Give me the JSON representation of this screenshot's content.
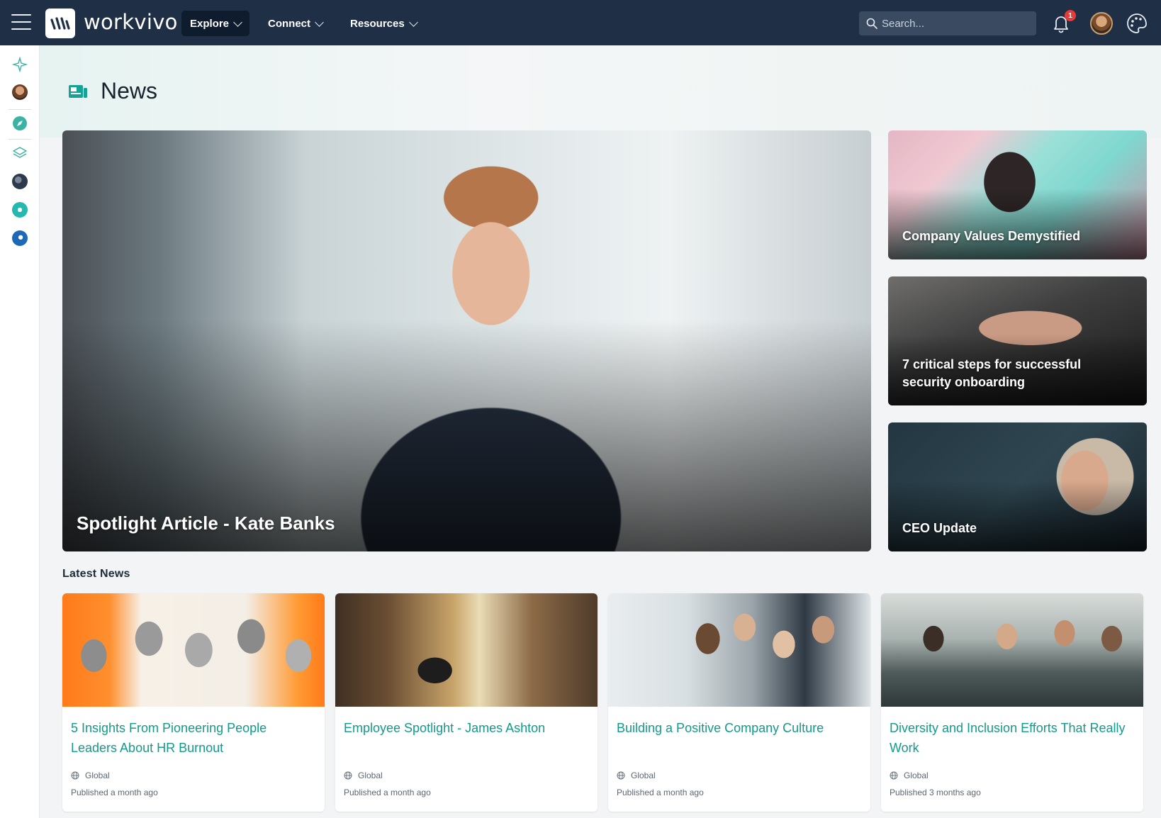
{
  "app": {
    "brand": "workvivo",
    "nav": [
      {
        "label": "Explore"
      },
      {
        "label": "Connect"
      },
      {
        "label": "Resources"
      }
    ],
    "search_placeholder": "Search...",
    "notification_count": "1"
  },
  "page": {
    "title": "News"
  },
  "featured": {
    "main": {
      "title": "Spotlight Article - Kate Banks"
    },
    "side": [
      {
        "title": "Company Values Demystified"
      },
      {
        "title": "7 critical steps for successful security onboarding"
      },
      {
        "title": "CEO Update"
      }
    ]
  },
  "latest": {
    "label": "Latest News",
    "cards": [
      {
        "title": "5 Insights From Pioneering People Leaders About HR Burnout",
        "scope": "Global",
        "published": "Published a month ago"
      },
      {
        "title": "Employee Spotlight - James Ashton",
        "scope": "Global",
        "published": "Published a month ago"
      },
      {
        "title": "Building a Positive Company Culture",
        "scope": "Global",
        "published": "Published a month ago"
      },
      {
        "title": "Diversity and Inclusion Efforts That Really Work",
        "scope": "Global",
        "published": "Published 3 months ago"
      }
    ]
  },
  "colors": {
    "nav_bg": "#1f2f45",
    "accent": "#149a8a",
    "badge": "#e43b3b"
  },
  "icons": {
    "menu": "hamburger-icon",
    "search": "search-icon",
    "bell": "bell-icon",
    "palette": "palette-icon",
    "news": "newspaper-icon",
    "globe": "globe-icon"
  }
}
